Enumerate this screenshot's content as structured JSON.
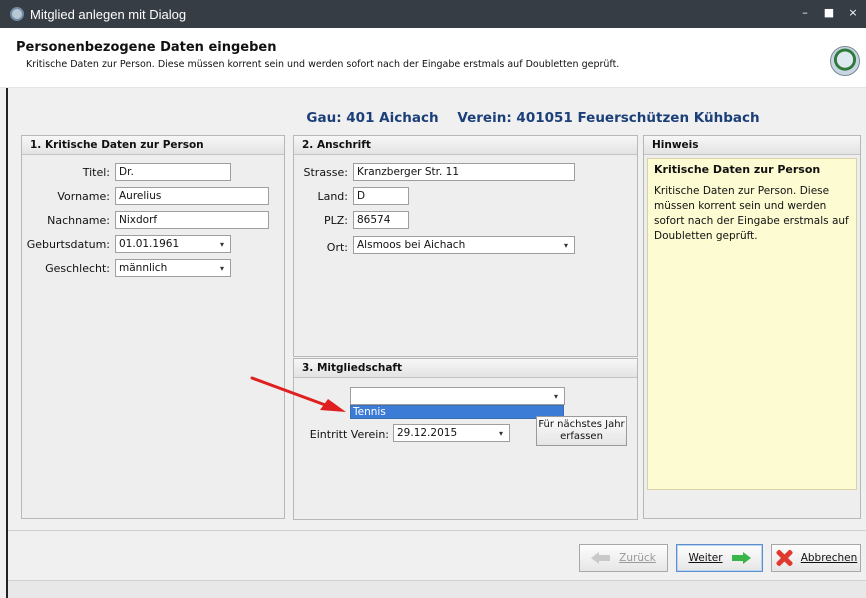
{
  "window": {
    "title": "Mitglied anlegen mit Dialog",
    "controls": [
      "–",
      "■",
      "×"
    ]
  },
  "banner": {
    "heading": "Personenbezogene Daten eingeben",
    "subtitle": "Kritische Daten zur Person. Diese müssen korrent sein und werden sofort nach der Eingabe erstmals auf Doubletten geprüft."
  },
  "context": {
    "gau": "Gau: 401 Aichach",
    "verein": "Verein: 401051 Feuerschützen Kühbach"
  },
  "person": {
    "header": "1. Kritische Daten zur Person",
    "titel_label": "Titel:",
    "titel": "Dr.",
    "vorname_label": "Vorname:",
    "vorname": "Aurelius",
    "nachname_label": "Nachname:",
    "nachname": "Nixdorf",
    "geburtsdatum_label": "Geburtsdatum:",
    "geburtsdatum": "01.01.1961",
    "geschlecht_label": "Geschlecht:",
    "geschlecht": "männlich"
  },
  "address": {
    "header": "2. Anschrift",
    "strasse_label": "Strasse:",
    "strasse": "Kranzberger Str. 11",
    "land_label": "Land:",
    "land": "D",
    "plz_label": "PLZ:",
    "plz": "86574",
    "ort_label": "Ort:",
    "ort": "Alsmoos bei Aichach"
  },
  "membership": {
    "header": "3. Mitgliedschaft",
    "selected": "",
    "option_highlighted": "Tennis",
    "eintritt_label": "Eintritt Verein:",
    "eintritt": "29.12.2015",
    "next_year_button": "Für nächstes Jahr erfassen"
  },
  "hint": {
    "header": "Hinweis",
    "title": "Kritische Daten zur Person",
    "body": "Kritische Daten zur Person. Diese müssen korrent sein und werden sofort nach der Eingabe erstmals auf Doubletten geprüft."
  },
  "footer": {
    "back": "Zurück",
    "next": "Weiter",
    "cancel": "Abbrechen"
  },
  "colors": {
    "titlebar": "#363d45",
    "context_text": "#1b3f78",
    "hint_bg": "#fcfbd2",
    "highlight": "#3d7cd6",
    "annotation_arrow": "#e02020"
  }
}
